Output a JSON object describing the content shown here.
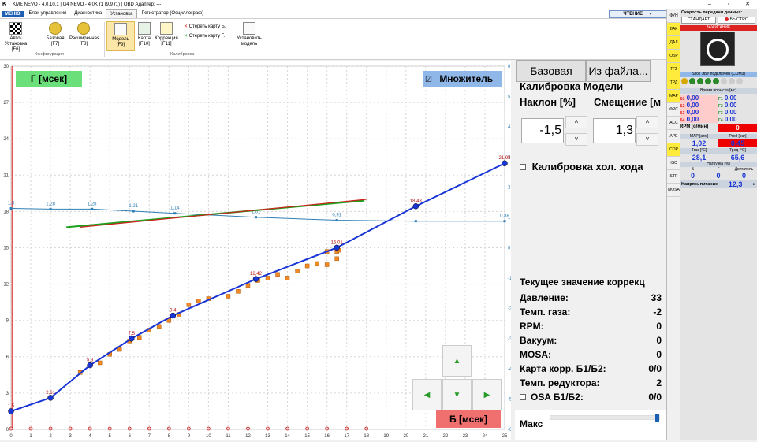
{
  "window": {
    "title": "KME NEVO - 4.0.10.1  |  G4 NEVO - 4.0K r1 (9.9 r1)  |  OBD Адаптер: ---",
    "logo": "K",
    "minimize": "–",
    "maximize": "▫",
    "close": "✕"
  },
  "menu": {
    "main": "МЕНЮ",
    "tabs": [
      "Блок управления",
      "Диагностика",
      "Установка",
      "Регистратор (Осциллограф)"
    ],
    "active_tab": 2,
    "read_button": "ЧТЕНИЕ",
    "read_chevron": "▼"
  },
  "ribbon": {
    "config_group": "Конфигурация",
    "calib_group": "Калибровка",
    "buttons": [
      {
        "label": "Авто-Установка",
        "key": "[F6]"
      },
      {
        "label": "Базовая",
        "key": "[F7]"
      },
      {
        "label": "Расширенная",
        "key": "[F8]"
      },
      {
        "label": "Модель",
        "key": "[F9]"
      },
      {
        "label": "Карта",
        "key": "[F10]"
      },
      {
        "label": "Коррекция",
        "key": "[F11]"
      }
    ],
    "erase_b": "Стереть карту Б.",
    "erase_g": "Стереть карту Г.",
    "set_model": "Установить модель",
    "erase_mark": "✕"
  },
  "chart": {
    "g_button": "Г [мсек]",
    "b_button": "Б [мсек]",
    "multiplier_label": "Множитель",
    "multiplier_checked": true,
    "check_glyph": "☑",
    "arrow_up": "▲",
    "arrow_down": "▼",
    "arrow_left": "◀",
    "arrow_right": "▶"
  },
  "chart_data": {
    "type": "scatter",
    "x_ticks": [
      0,
      1,
      2,
      3,
      4,
      5,
      6,
      7,
      8,
      9,
      10,
      11,
      12,
      13,
      14,
      15,
      16,
      17,
      18,
      19,
      20,
      21,
      22,
      23,
      24,
      25
    ],
    "xlim": [
      0,
      25
    ],
    "y_left_ticks": [
      0,
      3,
      6,
      9,
      12,
      15,
      18,
      21,
      24,
      27,
      30
    ],
    "ylim_left": [
      0,
      30
    ],
    "y_right_ticks": [
      -6,
      -5,
      -4,
      -3,
      -2,
      -1,
      0,
      1,
      2,
      3,
      4,
      5,
      6
    ],
    "ylim_right": [
      -6,
      6
    ],
    "model_line": {
      "color": "#1a35d6",
      "points": [
        [
          0,
          1.5
        ],
        [
          2,
          2.61
        ],
        [
          4,
          5.3
        ],
        [
          6.1,
          7.5
        ],
        [
          8.2,
          9.4
        ],
        [
          12.4,
          12.42
        ],
        [
          16.5,
          15.01
        ],
        [
          20.5,
          18.43
        ],
        [
          25,
          21.98
        ]
      ],
      "labels": [
        "1,5",
        "2,61",
        "5,3",
        "7,5",
        "9,4",
        "12,42",
        "15,01",
        "18,43",
        "21,98"
      ]
    },
    "multiplier_line": {
      "color": "#2f7fb5",
      "points": [
        [
          0,
          1.3
        ],
        [
          2,
          1.28
        ],
        [
          4.1,
          1.28
        ],
        [
          6.2,
          1.21
        ],
        [
          8.3,
          1.14
        ],
        [
          12.4,
          1.01
        ],
        [
          16.5,
          0.91
        ],
        [
          20.5,
          0.88
        ],
        [
          25,
          0.88
        ]
      ],
      "labels": [
        "1,3",
        "1,28",
        "1,28",
        "1,21",
        "1,14",
        "1,01",
        "0,91",
        "",
        "0,88"
      ]
    },
    "scatter_points": [
      [
        3.5,
        4.7
      ],
      [
        4,
        5.3
      ],
      [
        4.5,
        5.5
      ],
      [
        5,
        6.2
      ],
      [
        5.5,
        6.6
      ],
      [
        6,
        7.3
      ],
      [
        6.5,
        7.6
      ],
      [
        7,
        8.2
      ],
      [
        7.5,
        8.5
      ],
      [
        8,
        9
      ],
      [
        8.5,
        9.5
      ],
      [
        9,
        10.3
      ],
      [
        9.5,
        10.6
      ],
      [
        10,
        10.8
      ],
      [
        11,
        11
      ],
      [
        11.5,
        11.4
      ],
      [
        12,
        11.9
      ],
      [
        12.5,
        12.3
      ],
      [
        13,
        12.5
      ],
      [
        13.5,
        12.8
      ],
      [
        14,
        12.5
      ],
      [
        14.5,
        13.1
      ],
      [
        15,
        13.5
      ],
      [
        15.5,
        13.7
      ],
      [
        16,
        13.6
      ],
      [
        16.5,
        14.1
      ],
      [
        16,
        14.7
      ],
      [
        16.5,
        14.7
      ],
      [
        16.6,
        14.8
      ]
    ],
    "green_line": [
      [
        2.8,
        16.7
      ],
      [
        17.9,
        18.9
      ]
    ],
    "red_line": [
      [
        3.5,
        16.7
      ],
      [
        18,
        19
      ]
    ],
    "bottom_markers": [
      0,
      1,
      2,
      3,
      4,
      5,
      6,
      7,
      8,
      9,
      10,
      11,
      12,
      13,
      14,
      15,
      16,
      17,
      18
    ],
    "vertical_line_x": 0.05
  },
  "right_panel": {
    "base_button": "Базовая",
    "file_button": "Из файла...",
    "model_title": "Калибровка Модели",
    "slope_label": "Наклон [%]",
    "offset_label": "Смещение [м",
    "slope_value": "-1,5",
    "offset_value": "1,3",
    "spin_up": "˄",
    "spin_down": "˅",
    "idle_label": "Калибровка хол. хода",
    "idle_checked": false,
    "current_title": "Текущее значение коррекц",
    "rows": [
      {
        "label": "Давление:",
        "value": "33"
      },
      {
        "label": "Темп. газа:",
        "value": "-2"
      },
      {
        "label": "RPM:",
        "value": "0"
      },
      {
        "label": "Вакуум:",
        "value": "0"
      },
      {
        "label": "MOSA:",
        "value": "0"
      },
      {
        "label": "Карта корр. Б1/Б2:",
        "value": "0/0"
      },
      {
        "label": "Темп. редуктора:",
        "value": "2"
      },
      {
        "label": "OSA Б1/Б2:",
        "value": "0/0"
      }
    ],
    "max_label": "Макс"
  },
  "side_tabs": [
    "ФУН",
    "ВАК",
    "ДАЛ",
    "ОБР",
    "ТГЗ",
    "ТРД",
    "МАР",
    "ФРС",
    "АСС",
    "АРЕ",
    "СОР",
    "ISC",
    "STR",
    "MOSA"
  ],
  "mini_panel": {
    "speed_title": "Скорость передачи данных:",
    "std_button": "СТАНДАРТ",
    "fast_button": "БЫСТРО",
    "ignition_label": "ЗАЖИГАНИЕ",
    "ecu_label": "Блок ЭБУ подключен (СОМ3)",
    "inj_title": "Время впрыска [мс]",
    "b_values": [
      {
        "k": "Б1",
        "v": "0,00"
      },
      {
        "k": "Б2",
        "v": "0,00"
      },
      {
        "k": "Б3",
        "v": "0,00"
      },
      {
        "k": "Б4",
        "v": "0,00"
      }
    ],
    "g_values": [
      {
        "k": "Г1",
        "v": "0,00"
      },
      {
        "k": "Г2",
        "v": "0,00"
      },
      {
        "k": "Г3",
        "v": "0,00"
      },
      {
        "k": "Г4",
        "v": "0,00"
      }
    ],
    "rpm_label": "RPM [о/мин]",
    "rpm_value": "0",
    "map_label": "MAP [атм]",
    "map_value": "1,02",
    "pred_label": "Pred [bar]",
    "pred_value": "0,45",
    "tgas_label": "Тгаз [°C]",
    "tgas_value": "28,1",
    "tred_label": "Тред [°C]",
    "tred_value": "65,6",
    "load_title": "Нагрузка [%]",
    "load_b_label": "Б",
    "load_g_label": "Г",
    "load_eng_label": "Двигатель",
    "load_b": "0",
    "load_g": "0",
    "load_eng": "0",
    "voltage_label": "Напряж. питание",
    "voltage_value": "12,3",
    "voltage_arrow": "▸"
  },
  "colors": {
    "accent_blue": "#1c5fb4",
    "model_line": "#1a35d6",
    "scatter": "#f08a24",
    "g_button_bg": "#6be07a",
    "b_button_bg": "#f07070",
    "mult_bg": "#8fb7e8"
  }
}
